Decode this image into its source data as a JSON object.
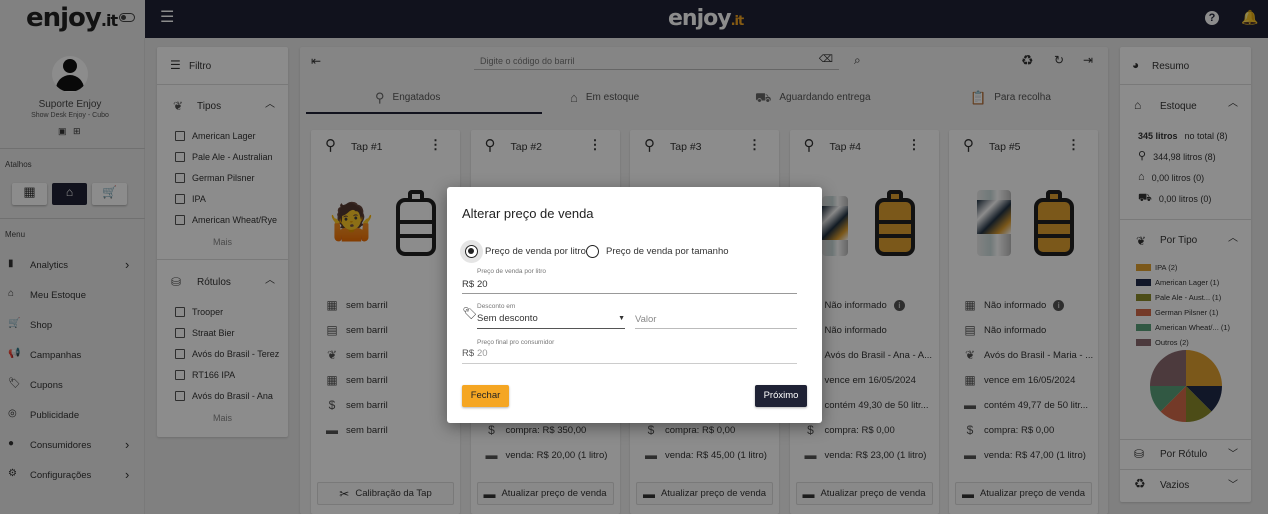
{
  "brand": {
    "logo_text": "enjoy",
    "logo_suffix": ".it",
    "accent": "#f5a623",
    "dark": "#1f2235"
  },
  "header": {
    "center_logo": "enjoy",
    "center_suffix": ".it"
  },
  "sidebar": {
    "user_name": "Suporte Enjoy",
    "user_sub": "Show Desk Enjoy - Cubo",
    "shortcuts_label": "Atalhos",
    "menu_label": "Menu",
    "items": [
      {
        "label": "Analytics",
        "icon": "bar-chart-icon",
        "chevron": "›"
      },
      {
        "label": "Meu Estoque",
        "icon": "warehouse-icon",
        "chevron": ""
      },
      {
        "label": "Shop",
        "icon": "cart-icon",
        "chevron": ""
      },
      {
        "label": "Campanhas",
        "icon": "megaphone-icon",
        "chevron": ""
      },
      {
        "label": "Cupons",
        "icon": "tag-icon",
        "chevron": ""
      },
      {
        "label": "Publicidade",
        "icon": "target-icon",
        "chevron": ""
      },
      {
        "label": "Consumidores",
        "icon": "person-icon",
        "chevron": "›"
      },
      {
        "label": "Configurações",
        "icon": "gear-icon",
        "chevron": "›"
      }
    ]
  },
  "filter": {
    "title": "Filtro",
    "types_title": "Tipos",
    "types": [
      "American Lager",
      "Pale Ale - Australian",
      "German Pilsner",
      "IPA",
      "American Wheat/Rye"
    ],
    "more": "Mais",
    "labels_title": "Rótulos",
    "labels": [
      "Trooper",
      "Straat Bier",
      "Avós do Brasil - Terez",
      "RT166 IPA",
      "Avós do Brasil - Ana"
    ],
    "more2": "Mais"
  },
  "toolbar": {
    "search_placeholder": "Digite o código do barril"
  },
  "tabs": [
    {
      "label": "Engatados",
      "icon": "tap-icon"
    },
    {
      "label": "Em estoque",
      "icon": "warehouse-icon"
    },
    {
      "label": "Aguardando entrega",
      "icon": "truck-icon"
    },
    {
      "label": "Para recolha",
      "icon": "clipboard-icon"
    }
  ],
  "taps": [
    {
      "title": "Tap #1",
      "rows": [
        "sem barril",
        "sem barril",
        "sem barril",
        "sem barril",
        "sem barril",
        "sem barril"
      ],
      "button": "Calibração da Tap"
    },
    {
      "title": "Tap #2",
      "rows": [
        "",
        "",
        "",
        "",
        "compra: R$ 350,00",
        "venda: R$ 20,00 (1 litro)"
      ],
      "button": "Atualizar preço de venda"
    },
    {
      "title": "Tap #3",
      "rows": [
        "",
        "",
        "",
        "",
        "compra: R$ 0,00",
        "venda: R$ 45,00 (1 litro)"
      ],
      "button": "Atualizar preço de venda"
    },
    {
      "title": "Tap #4",
      "rows": [
        "Não informado",
        "Não informado",
        "Avós do Brasil - Ana - A...",
        "vence em 16/05/2024",
        "contém 49,30 de 50 litr...",
        "compra: R$ 0,00",
        "venda: R$ 23,00 (1 litro)"
      ],
      "button": "Atualizar preço de venda"
    },
    {
      "title": "Tap #5",
      "rows": [
        "Não informado",
        "Não informado",
        "Avós do Brasil - Maria - ...",
        "vence em 16/05/2024",
        "contém 49,77 de 50 litr...",
        "compra: R$ 0,00",
        "venda: R$ 47,00 (1 litro)"
      ],
      "button": "Atualizar preço de venda"
    }
  ],
  "summary": {
    "title": "Resumo",
    "stock_title": "Estoque",
    "total": "345 litros",
    "total_suffix": "no total (8)",
    "tapped": "344,98 litros (8)",
    "stock": "0,00 litros (0)",
    "delivery": "0,00 litros (0)",
    "by_type_title": "Por Tipo",
    "legend": [
      {
        "label": "IPA (2)",
        "color": "#e0a030"
      },
      {
        "label": "American Lager (1)",
        "color": "#1f2a4a"
      },
      {
        "label": "Pale Ale - Aust... (1)",
        "color": "#8a8a2a"
      },
      {
        "label": "German Pilsner (1)",
        "color": "#d46a4a"
      },
      {
        "label": "American Wheat/... (1)",
        "color": "#5aa07a"
      },
      {
        "label": "Outros (2)",
        "color": "#8a6a70"
      }
    ],
    "by_label_title": "Por Rótulo",
    "empty_title": "Vazios"
  },
  "modal": {
    "title": "Alterar preço de venda",
    "radio1": "Preço de venda por litro",
    "radio2": "Preço de venda por tamanho",
    "price_label": "Preço de venda por litro",
    "currency": "R$",
    "price_value": "20",
    "discount_label": "Desconto em",
    "discount_value": "Sem desconto",
    "value_placeholder": "Valor",
    "final_label": "Preço final pro consumidor",
    "final_currency": "R$",
    "final_value": "20",
    "close": "Fechar",
    "next": "Próximo"
  }
}
